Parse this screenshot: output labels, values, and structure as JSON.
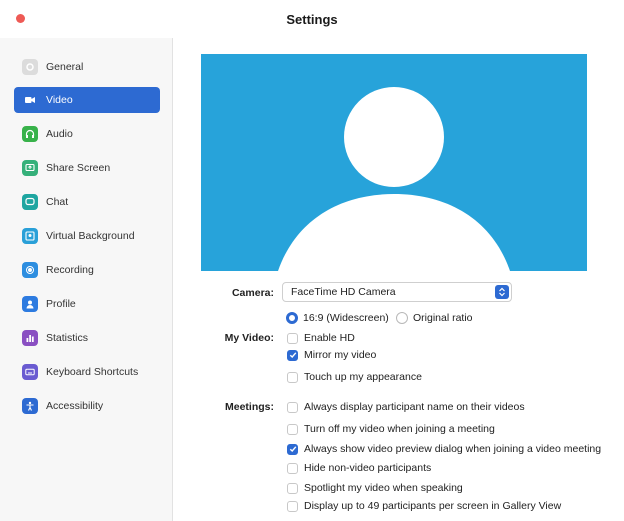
{
  "window": {
    "title": "Settings"
  },
  "colors": {
    "accent": "#2d6ad2",
    "preview_bg": "#27a3da",
    "close": "#ee5a55"
  },
  "sidebar": {
    "items": [
      {
        "label": "General",
        "icon": "gear-icon",
        "color": "#d9d9d9",
        "selected": false
      },
      {
        "label": "Video",
        "icon": "video-camera-icon",
        "color": "#2d6ad2",
        "selected": true
      },
      {
        "label": "Audio",
        "icon": "headphones-icon",
        "color": "#38b24a",
        "selected": false
      },
      {
        "label": "Share Screen",
        "icon": "share-screen-icon",
        "color": "#35b07a",
        "selected": false
      },
      {
        "label": "Chat",
        "icon": "chat-icon",
        "color": "#1ea6a1",
        "selected": false
      },
      {
        "label": "Virtual Background",
        "icon": "virtual-background-icon",
        "color": "#2aa0d8",
        "selected": false
      },
      {
        "label": "Recording",
        "icon": "recording-icon",
        "color": "#2d8ee0",
        "selected": false
      },
      {
        "label": "Profile",
        "icon": "profile-icon",
        "color": "#2d7be0",
        "selected": false
      },
      {
        "label": "Statistics",
        "icon": "statistics-icon",
        "color": "#8a4fc2",
        "selected": false
      },
      {
        "label": "Keyboard Shortcuts",
        "icon": "keyboard-icon",
        "color": "#6a5bd1",
        "selected": false
      },
      {
        "label": "Accessibility",
        "icon": "accessibility-icon",
        "color": "#2d6ad2",
        "selected": false
      }
    ]
  },
  "video": {
    "camera_label": "Camera:",
    "camera_value": "FaceTime HD Camera",
    "ratio": {
      "widescreen": "16:9 (Widescreen)",
      "original": "Original ratio",
      "selected": "widescreen"
    },
    "my_video_label": "My Video:",
    "my_video": [
      {
        "label": "Enable HD",
        "checked": false
      },
      {
        "label": "Mirror my video",
        "checked": true
      },
      {
        "label": "Touch up my appearance",
        "checked": false
      }
    ],
    "meetings_label": "Meetings:",
    "meetings": [
      {
        "label": "Always display participant name on their videos",
        "checked": false
      },
      {
        "label": "Turn off my video when joining a meeting",
        "checked": false
      },
      {
        "label": "Always show video preview dialog when joining a video meeting",
        "checked": true
      },
      {
        "label": "Hide non-video participants",
        "checked": false
      },
      {
        "label": "Spotlight my video when speaking",
        "checked": false
      },
      {
        "label": "Display up to 49 participants per screen in Gallery View",
        "checked": false
      }
    ]
  }
}
